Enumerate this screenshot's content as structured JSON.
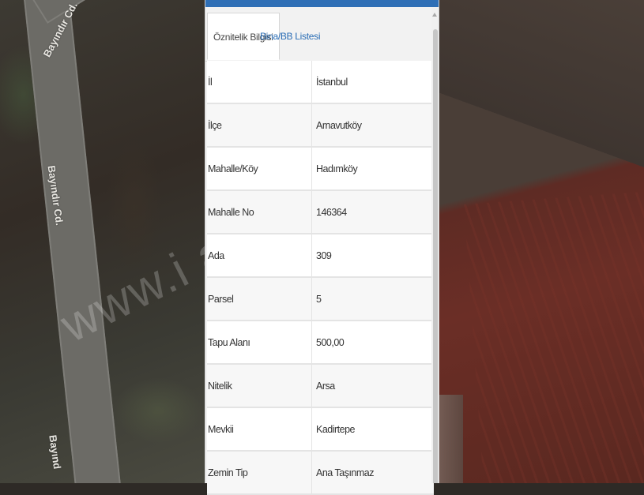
{
  "map": {
    "road_labels": [
      "Bayındır Cd.",
      "Bayındır Cd.",
      "Bayınd"
    ],
    "watermark": "www.i                a.net.tr"
  },
  "panel": {
    "tabs": [
      {
        "label": "Öznitelik Bilgisi",
        "active": true
      },
      {
        "label": "Bina/BB Listesi",
        "active": false
      }
    ],
    "rows": [
      {
        "key": "İl",
        "value": "İstanbul"
      },
      {
        "key": "İlçe",
        "value": "Arnavutköy"
      },
      {
        "key": "Mahalle/Köy",
        "value": "Hadımköy"
      },
      {
        "key": "Mahalle No",
        "value": "146364"
      },
      {
        "key": "Ada",
        "value": "309"
      },
      {
        "key": "Parsel",
        "value": "5"
      },
      {
        "key": "Tapu Alanı",
        "value": "500,00"
      },
      {
        "key": "Nitelik",
        "value": "Arsa"
      },
      {
        "key": "Mevkii",
        "value": "Kadirtepe"
      },
      {
        "key": "Zemin Tip",
        "value": "Ana Taşınmaz"
      }
    ],
    "accent_color": "#2f6fb6",
    "link_color": "#2a6db5"
  }
}
